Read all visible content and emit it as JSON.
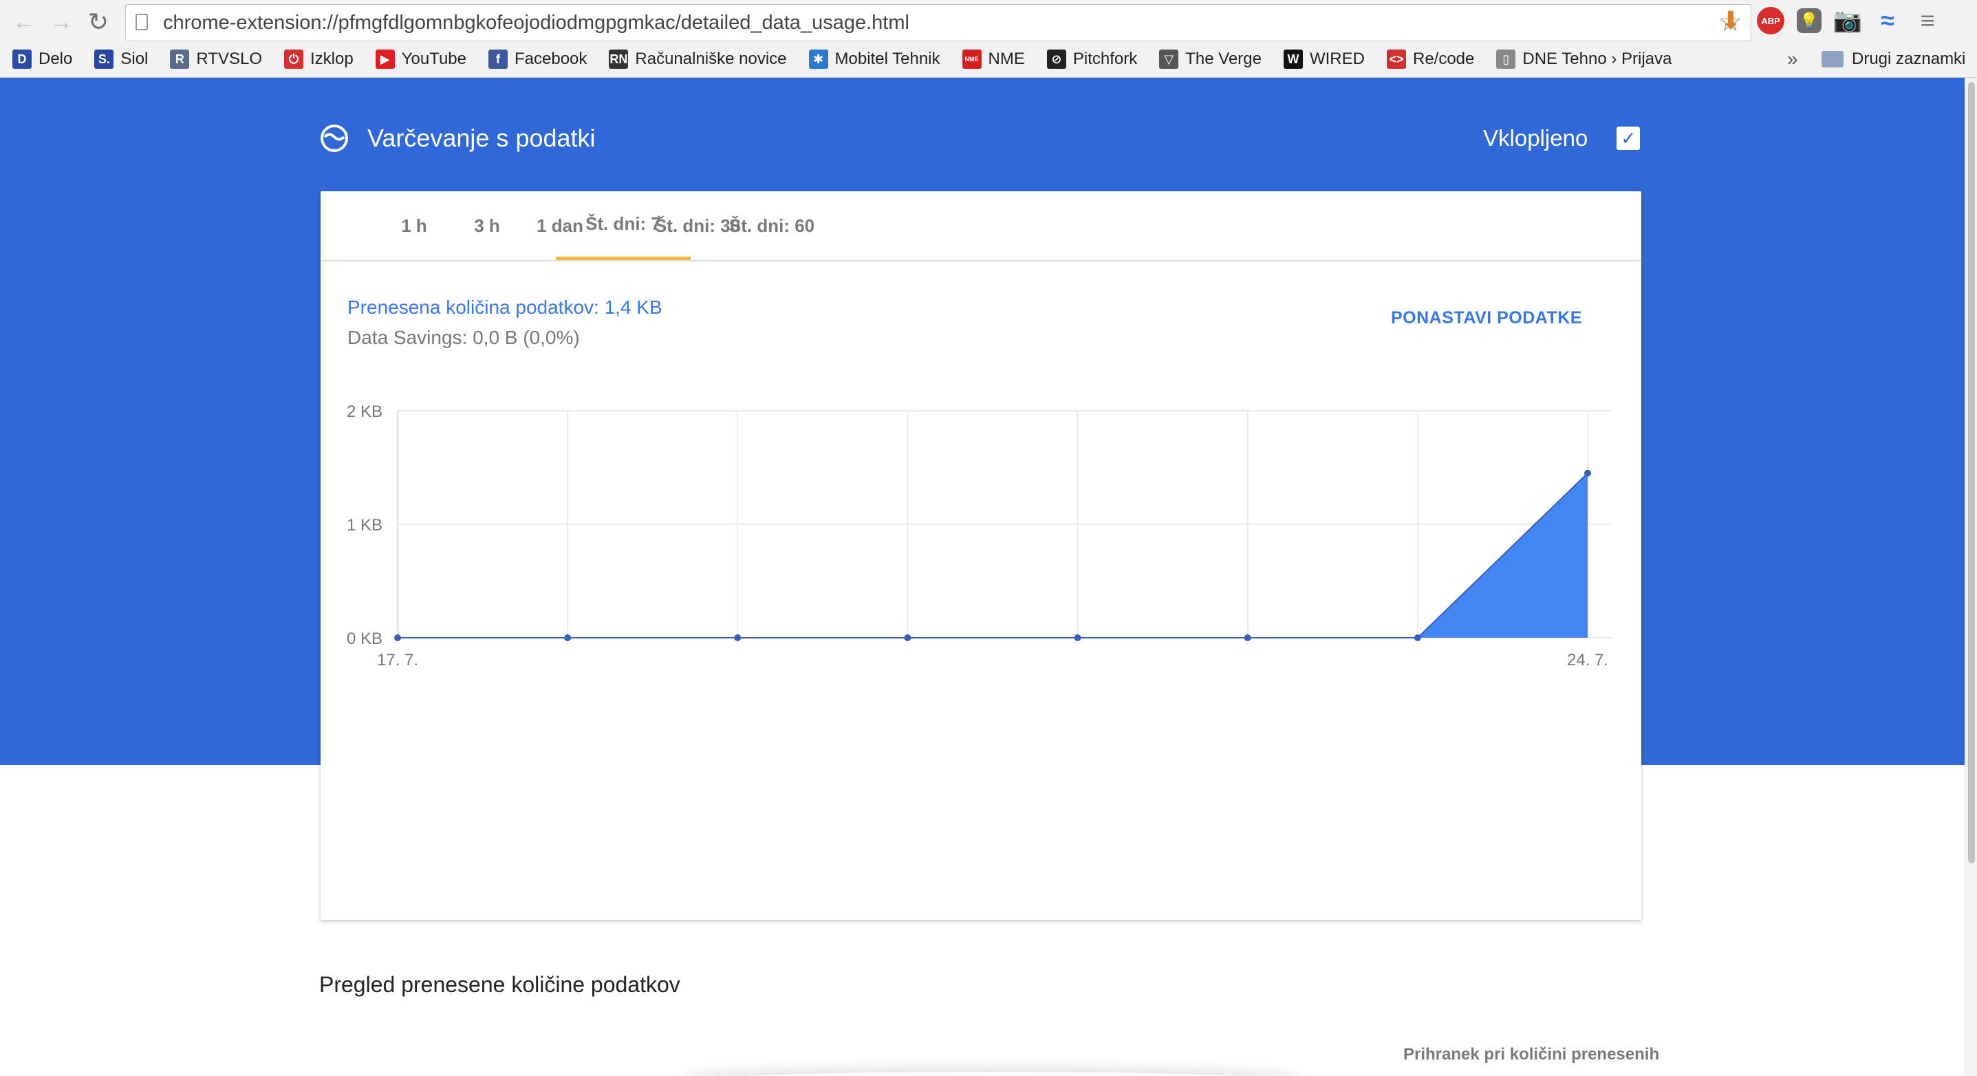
{
  "browser": {
    "url": "chrome-extension://pfmgfdlgomnbgkofeojodiodmgpgmkac/detailed_data_usage.html",
    "bookmarks": [
      {
        "label": "Delo",
        "icon": "D",
        "color": "#2a4ea8"
      },
      {
        "label": "Siol",
        "icon": "S.",
        "color": "#2a46a0"
      },
      {
        "label": "RTVSLO",
        "icon": "R",
        "color": "#5a6c8c"
      },
      {
        "label": "Izklop",
        "icon": "⏻",
        "color": "#d43030"
      },
      {
        "label": "YouTube",
        "icon": "▶",
        "color": "#e02020"
      },
      {
        "label": "Facebook",
        "icon": "f",
        "color": "#3b5998"
      },
      {
        "label": "Računalniške novice",
        "icon": "RN",
        "color": "#333333"
      },
      {
        "label": "Mobitel Tehnik",
        "icon": "✱",
        "color": "#2a7ad0"
      },
      {
        "label": "NME",
        "icon": "NME",
        "color": "#d42020"
      },
      {
        "label": "Pitchfork",
        "icon": "⊘",
        "color": "#222222"
      },
      {
        "label": "The Verge",
        "icon": "▽",
        "color": "#555555"
      },
      {
        "label": "WIRED",
        "icon": "W",
        "color": "#111111"
      },
      {
        "label": "Re/code",
        "icon": "<>",
        "color": "#d03030"
      },
      {
        "label": "DNE Tehno › Prijava",
        "icon": "▯",
        "color": "#888888"
      }
    ],
    "bookmarks_more": "»",
    "other_bookmarks": "Drugi zaznamki",
    "extension_icons": [
      "download-icon",
      "adblock-icon",
      "bulb-icon",
      "camera-icon",
      "data-saver-icon",
      "menu-icon"
    ],
    "abp_label": "ABP"
  },
  "app": {
    "title": "Varčevanje s podatki",
    "enabled_label": "Vklopljeno",
    "enabled": true
  },
  "tabs": [
    {
      "label": "1 h",
      "active": false
    },
    {
      "label": "3 h",
      "active": false
    },
    {
      "label": "1 dan",
      "active": false
    },
    {
      "label": "Št. dni: 7",
      "active": true
    },
    {
      "label": "Št. dni: 30",
      "active": false
    },
    {
      "label": "Št. dni: 60",
      "active": false
    }
  ],
  "summary": {
    "total_text": "Prenesena količina podatkov: 1,4 KB",
    "savings_text": "Data Savings: 0,0 B (0,0%)",
    "reset_label": "PONASTAVI PODATKE"
  },
  "chart_data": {
    "type": "area",
    "x_labels": [
      "17. 7.",
      "",
      "",
      "",
      "",
      "",
      "",
      "24. 7."
    ],
    "values": [
      0,
      0,
      0,
      0,
      0,
      0,
      0,
      1.45
    ],
    "y_ticks": [
      {
        "value": 0,
        "label": "0 KB"
      },
      {
        "value": 1,
        "label": "1 KB"
      },
      {
        "value": 2,
        "label": "2 KB"
      }
    ],
    "ylim": [
      0,
      2
    ],
    "grid": true,
    "colors": {
      "fill": "#4286f4",
      "line": "#3a5fb8",
      "grid": "#ebebeb"
    }
  },
  "section": {
    "title": "Pregled prenesene količine podatkov",
    "table_header_hint": "Prihranek pri količini prenesenih"
  }
}
